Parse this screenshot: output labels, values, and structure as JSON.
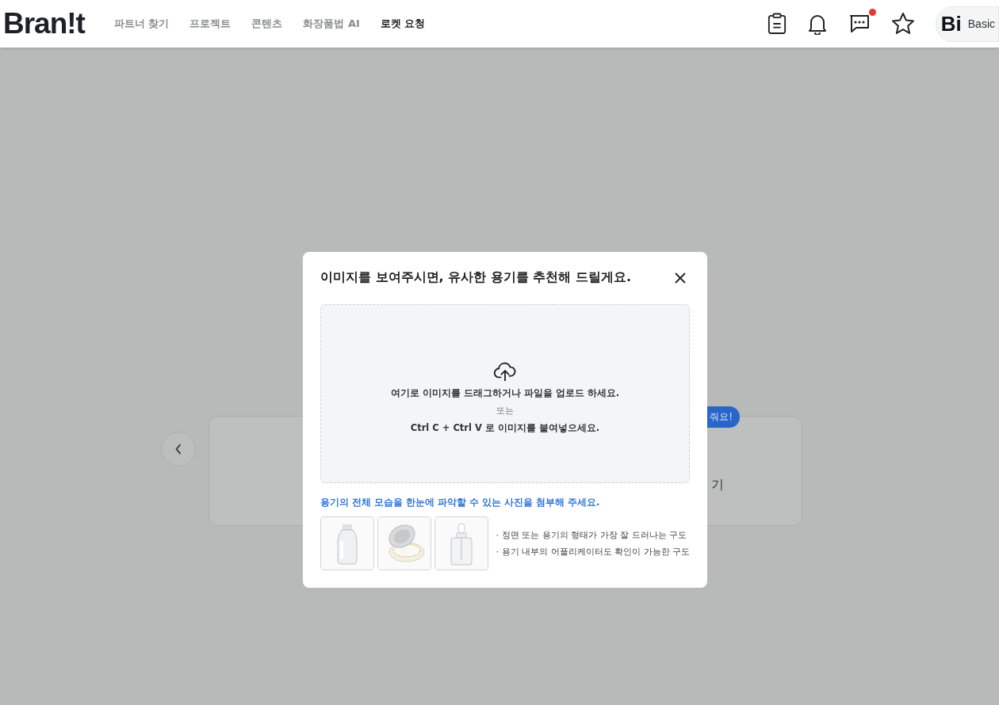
{
  "header": {
    "logo": "Bran!t",
    "nav": [
      {
        "label": "파트너 찾기",
        "selected": false
      },
      {
        "label": "프로젝트",
        "selected": false
      },
      {
        "label": "콘텐츠",
        "selected": false
      },
      {
        "label": "화장품법 AI",
        "selected": false
      },
      {
        "label": "로켓 요청",
        "selected": true
      }
    ],
    "messages_unread": true,
    "profile": {
      "initials": "Bi",
      "plan": "Basic"
    }
  },
  "background": {
    "badge": "줘요!",
    "card_text": "기"
  },
  "modal": {
    "title": "이미지를 보여주시면, 유사한 용기를 추천해 드릴게요.",
    "dropzone": {
      "line_1": "여기로 이미지를 드래그하거나 파일을 업로드 하세요.",
      "line_2": "또는",
      "line_3": "Ctrl C + Ctrl V 로 이미지를 붙여넣으세요."
    },
    "hint": "용기의 전체 모습을 한눈에 파악할 수 있는 사진을 첨부해 주세요.",
    "examples": [
      {
        "kind": "picture"
      },
      {
        "kind": "picture"
      },
      {
        "kind": "picture"
      }
    ],
    "tips": [
      "· 정면 또는 용기의 형태가 가장 잘 드러나는 구도",
      "· 용기 내부의 어플리케이터도 확인이 가능한 구도"
    ]
  }
}
